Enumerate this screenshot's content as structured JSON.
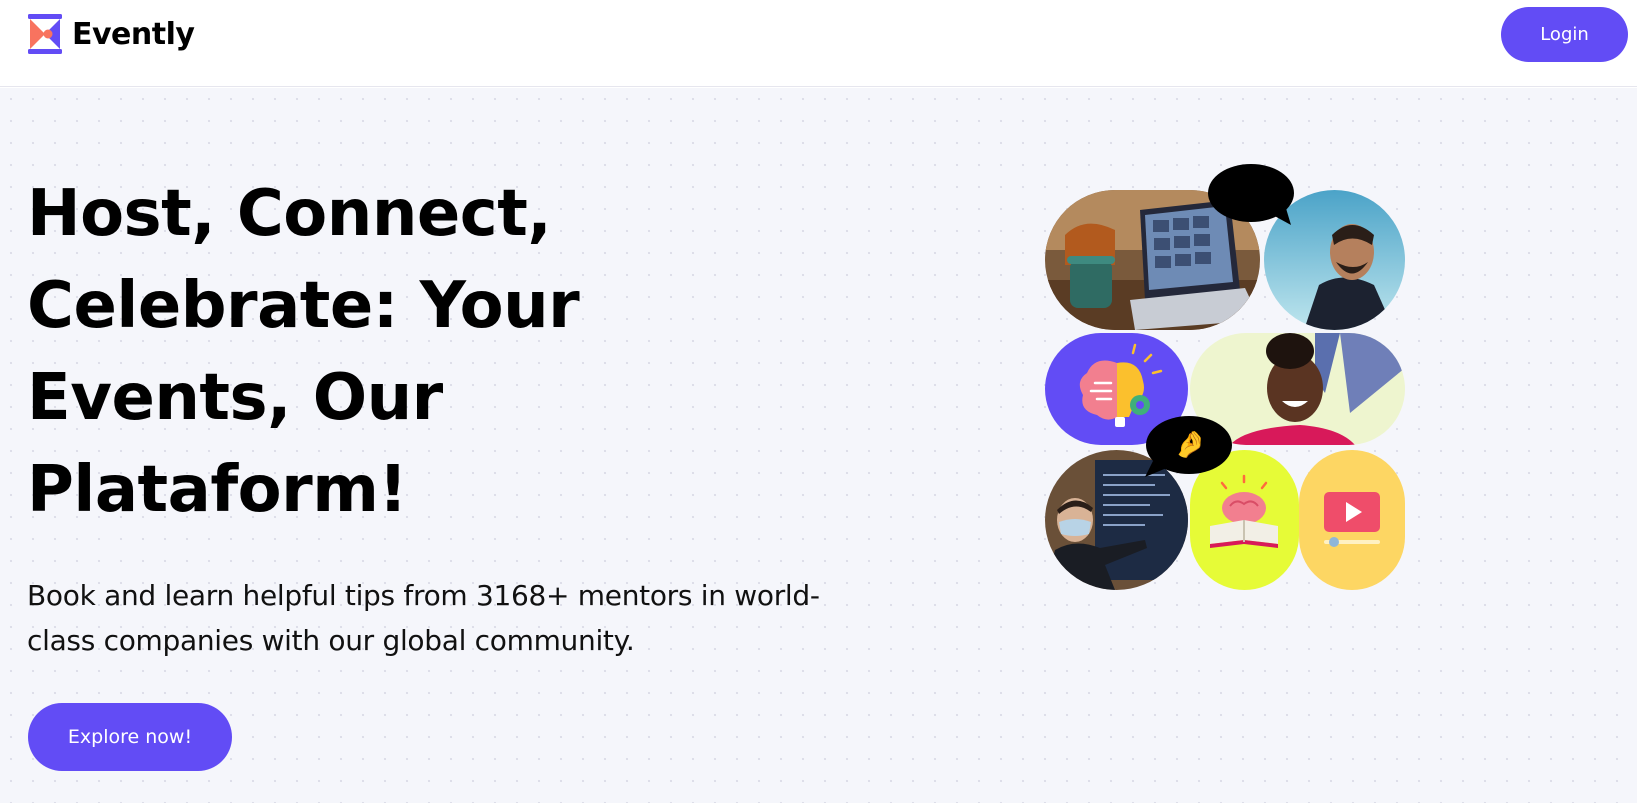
{
  "brand": {
    "name": "Evently",
    "logo_icon": "evently-logo-icon",
    "accent": "#624cf5"
  },
  "nav": {
    "login_label": "Login"
  },
  "hero": {
    "title": "Host, Connect, Celebrate: Your Events, Our Plataform!",
    "subtitle": "Book and learn helpful tips from 3168+ mentors in world-class companies with our global community.",
    "cta_label": "Explore now!"
  },
  "collage": {
    "tiles": [
      {
        "icon": "video-call-laptop-photo"
      },
      {
        "icon": "laughing-man-photo"
      },
      {
        "icon": "brain-lightbulb-icon",
        "color": "#624cf5"
      },
      {
        "icon": "smiling-woman-photo"
      },
      {
        "icon": "presenter-photo"
      },
      {
        "icon": "brain-book-icon",
        "color": "#e6fb37"
      },
      {
        "icon": "video-play-icon",
        "color": "#fdd663"
      }
    ],
    "bubbles": [
      {
        "emoji": "😍",
        "icon": "heart-eyes-emoji"
      },
      {
        "emoji": "🤌",
        "icon": "pinched-fingers-emoji"
      }
    ]
  }
}
